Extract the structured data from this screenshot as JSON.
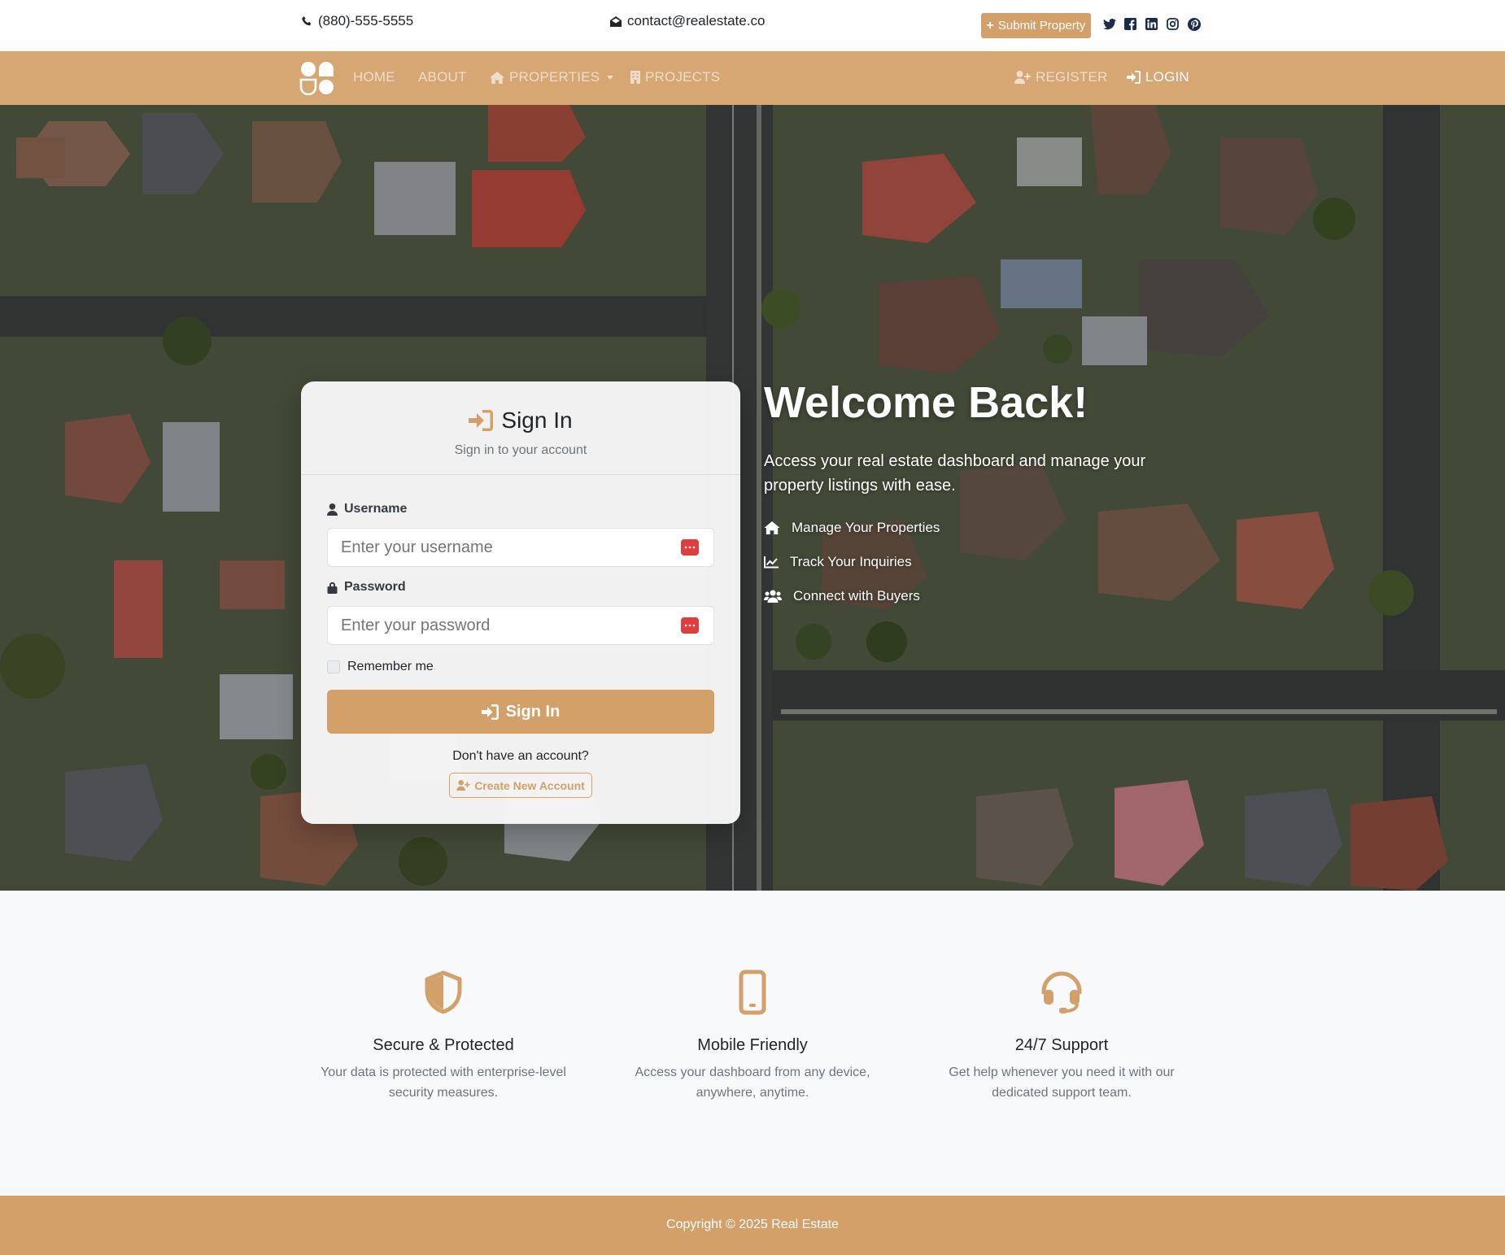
{
  "topbar": {
    "phone": "(880)-555-5555",
    "email": "contact@realestate.co",
    "submit_label": "Submit Property",
    "social": [
      "twitter-icon",
      "facebook-icon",
      "linkedin-icon",
      "instagram-icon",
      "pinterest-icon"
    ]
  },
  "nav": {
    "items": [
      {
        "label": "HOME"
      },
      {
        "label": "ABOUT"
      },
      {
        "label": "PROPERTIES"
      },
      {
        "label": "PROJECTS"
      }
    ],
    "register_label": "REGISTER",
    "login_label": "LOGIN"
  },
  "signin": {
    "title": "Sign In",
    "subtitle": "Sign in to your account",
    "username_label": "Username",
    "username_placeholder": "Enter your username",
    "password_label": "Password",
    "password_placeholder": "Enter your password",
    "remember_label": "Remember me",
    "button_label": "Sign In",
    "no_account_text": "Don't have an account?",
    "create_label": "Create New Account"
  },
  "welcome": {
    "title": "Welcome Back!",
    "text": "Access your real estate dashboard and manage your property listings with ease.",
    "items": [
      {
        "icon": "home-icon",
        "label": "Manage Your Properties"
      },
      {
        "icon": "chart-line-icon",
        "label": "Track Your Inquiries"
      },
      {
        "icon": "users-icon",
        "label": "Connect with Buyers"
      }
    ]
  },
  "features": [
    {
      "icon": "shield-icon",
      "title": "Secure & Protected",
      "text": "Your data is protected with enterprise-level security measures."
    },
    {
      "icon": "mobile-icon",
      "title": "Mobile Friendly",
      "text": "Access your dashboard from any device, anywhere, anytime."
    },
    {
      "icon": "headset-icon",
      "title": "24/7 Support",
      "text": "Get help whenever you need it with our dedicated support team."
    }
  ],
  "footer": {
    "copyright": "Copyright © 2025 Real Estate"
  },
  "colors": {
    "accent": "#d4a06a",
    "navbar": "#d6a673",
    "password_manager_icon": "#e03e3e"
  }
}
